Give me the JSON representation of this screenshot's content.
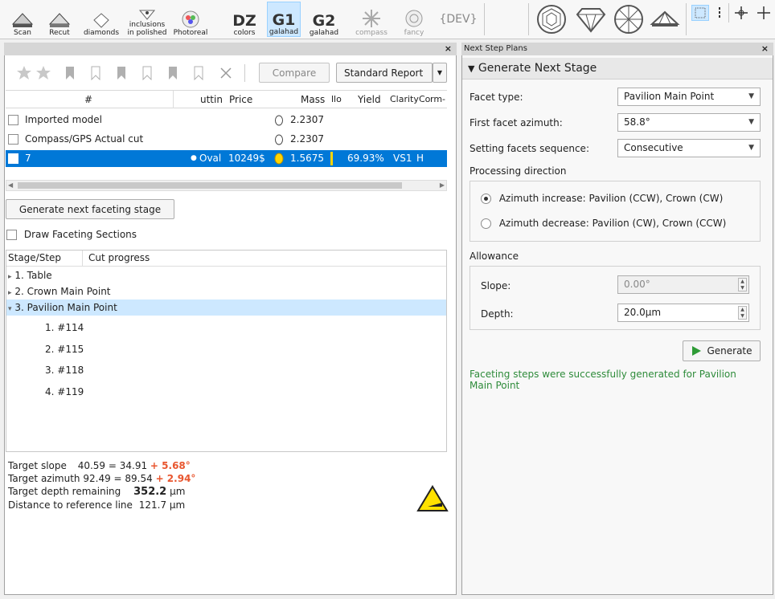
{
  "toolbar": {
    "buttons": [
      {
        "label": "Scan"
      },
      {
        "label": "Recut"
      },
      {
        "label": "diamonds"
      },
      {
        "label": "inclusions",
        "label2": "in polished"
      },
      {
        "label": "Photoreal"
      },
      {
        "big": "DZ",
        "label": "colors"
      },
      {
        "big": "G1",
        "label": "galahad"
      },
      {
        "big": "G2",
        "label": "galahad"
      },
      {
        "label": "compass"
      },
      {
        "label": "fancy"
      },
      {
        "big": "{DEV}"
      }
    ]
  },
  "left": {
    "models_table": {
      "compare": "Compare",
      "standard_report": "Standard Report",
      "headers": [
        "#",
        "uttin",
        "Price",
        "Mass",
        "llo",
        "Yield",
        "Clarity",
        "Co",
        "rm-"
      ],
      "rows": [
        {
          "name": "Imported model",
          "mass": "2.2307"
        },
        {
          "name": "Compass/GPS Actual cut",
          "mass": "2.2307"
        },
        {
          "name": "7",
          "shape": "Oval",
          "price": "10249$",
          "mass": "1.5675",
          "yield": "69.93%",
          "clarity": "VS1",
          "color": "H"
        }
      ]
    },
    "generate_button": "Generate next faceting stage",
    "draw_sections": "Draw Faceting Sections",
    "stage_headers": {
      "stage": "Stage/Step",
      "progress": "Cut progress"
    },
    "stages": [
      {
        "label": "1. Table",
        "arrow": "▸"
      },
      {
        "label": "2. Crown Main Point",
        "arrow": "▸"
      },
      {
        "label": "3. Pavilion Main Point",
        "arrow": "▾"
      }
    ],
    "steps": [
      "1. #114",
      "2. #115",
      "3. #118",
      "4. #119"
    ],
    "info": {
      "slope_label": "Target slope",
      "slope_eq": "40.59 = 34.91",
      "slope_delta": "+ 5.68°",
      "azimuth_label": "Target azimuth",
      "azimuth_eq": "92.49 = 89.54",
      "azimuth_delta": "+ 2.94°",
      "depth_label": "Target depth remaining",
      "depth_value": "352.2",
      "depth_unit": "μm",
      "distance_label": "Distance to reference line",
      "distance_value": "121.7 μm"
    },
    "colors": {
      "accent": "#e8552e",
      "selection": "#0078d7"
    }
  },
  "right": {
    "panel_title": "Next Step Plans",
    "section": "Generate Next Stage",
    "facet_type_label": "Facet type:",
    "facet_type": "Pavilion Main Point",
    "first_azimuth_label": "First facet azimuth:",
    "first_azimuth": "58.8°",
    "sequence_label": "Setting facets sequence:",
    "sequence": "Consecutive",
    "direction_title": "Processing direction",
    "dir_inc": "Azimuth increase: Pavilion (CCW), Crown (CW)",
    "dir_dec": "Azimuth decrease: Pavilion (CW), Crown (CCW)",
    "allowance_title": "Allowance",
    "slope_label": "Slope:",
    "slope": "0.00°",
    "depth_label": "Depth:",
    "depth": "20.0μm",
    "generate": "Generate",
    "status": "Faceting steps were successfully generated for Pavilion Main Point",
    "status_color": "#2e8b3a"
  }
}
